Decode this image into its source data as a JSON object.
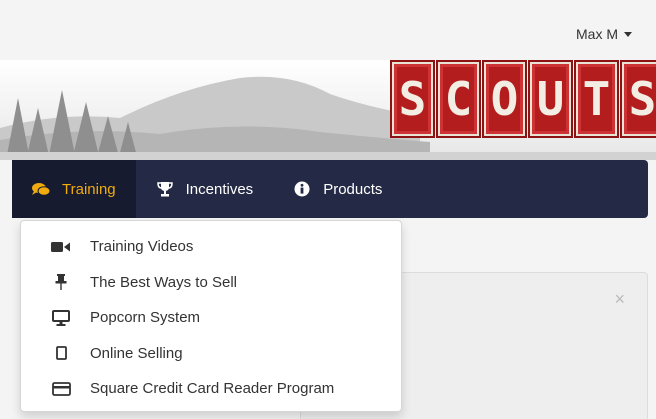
{
  "header": {
    "user_name": "Max M"
  },
  "logo": {
    "letters": [
      "S",
      "C",
      "O",
      "U",
      "T",
      "S"
    ]
  },
  "nav": {
    "items": [
      {
        "label": "Training",
        "icon": "comments-icon",
        "active": true
      },
      {
        "label": "Incentives",
        "icon": "trophy-icon",
        "active": false
      },
      {
        "label": "Products",
        "icon": "info-circle-icon",
        "active": false
      }
    ]
  },
  "dropdown": {
    "items": [
      {
        "label": "Training Videos",
        "icon": "video-camera-icon"
      },
      {
        "label": "The Best Ways to Sell",
        "icon": "pushpin-icon"
      },
      {
        "label": "Popcorn System",
        "icon": "desktop-icon"
      },
      {
        "label": "Online Selling",
        "icon": "tablet-icon"
      },
      {
        "label": "Square Credit Card Reader Program",
        "icon": "credit-card-icon"
      }
    ]
  },
  "panel": {
    "close_label": "×"
  },
  "colors": {
    "navbar": "#242a45",
    "active_text": "#f0ab0e",
    "logo_red": "#b41d1e"
  }
}
